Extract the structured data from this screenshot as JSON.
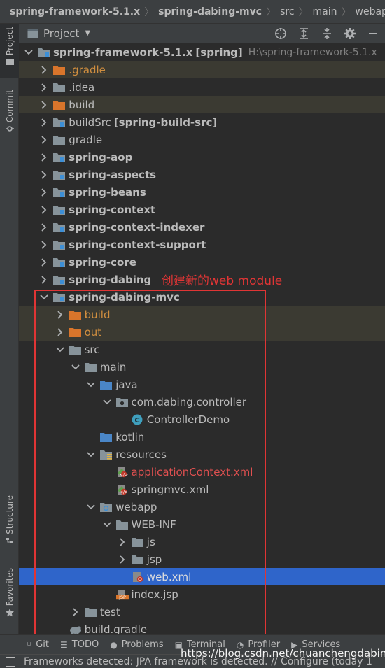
{
  "breadcrumb": {
    "items": [
      {
        "label": "spring-framework-5.1.x",
        "bold": true
      },
      {
        "label": "spring-dabing-mvc",
        "bold": true
      },
      {
        "label": "src",
        "bold": false
      },
      {
        "label": "main",
        "bold": false
      },
      {
        "label": "webapp",
        "bold": false
      }
    ]
  },
  "left_stripe": {
    "project": "Project",
    "commit": "Commit",
    "structure": "Structure",
    "favorites": "Favorites"
  },
  "project_panel": {
    "title": "Project",
    "tools": [
      "locate-icon",
      "expand-all-icon",
      "collapse-all-icon",
      "settings-icon",
      "hide-icon"
    ]
  },
  "tree": [
    {
      "depth": 0,
      "arrow": "down",
      "icon": "module-folder",
      "label": "spring-framework-5.1.x",
      "label_bold": true,
      "suffix": "[spring]",
      "hint": "H:\\spring-framework-5.1.x",
      "style": "normal"
    },
    {
      "depth": 1,
      "arrow": "right",
      "icon": "excluded-folder",
      "label": ".gradle",
      "style": "orange",
      "row": "excluded"
    },
    {
      "depth": 1,
      "arrow": "right",
      "icon": "folder",
      "label": ".idea",
      "style": "normal"
    },
    {
      "depth": 1,
      "arrow": "right",
      "icon": "excluded-folder",
      "label": "build",
      "style": "normal",
      "row": "excluded"
    },
    {
      "depth": 1,
      "arrow": "right",
      "icon": "module-folder",
      "label": "buildSrc",
      "suffix": "[spring-build-src]",
      "style": "normal"
    },
    {
      "depth": 1,
      "arrow": "right",
      "icon": "folder",
      "label": "gradle",
      "style": "normal"
    },
    {
      "depth": 1,
      "arrow": "right",
      "icon": "module-folder",
      "label": "spring-aop",
      "label_bold": true,
      "style": "normal"
    },
    {
      "depth": 1,
      "arrow": "right",
      "icon": "module-folder",
      "label": "spring-aspects",
      "label_bold": true,
      "style": "normal"
    },
    {
      "depth": 1,
      "arrow": "right",
      "icon": "module-folder",
      "label": "spring-beans",
      "label_bold": true,
      "style": "normal"
    },
    {
      "depth": 1,
      "arrow": "right",
      "icon": "module-folder",
      "label": "spring-context",
      "label_bold": true,
      "style": "normal"
    },
    {
      "depth": 1,
      "arrow": "right",
      "icon": "module-folder",
      "label": "spring-context-indexer",
      "label_bold": true,
      "style": "normal"
    },
    {
      "depth": 1,
      "arrow": "right",
      "icon": "module-folder",
      "label": "spring-context-support",
      "label_bold": true,
      "style": "normal"
    },
    {
      "depth": 1,
      "arrow": "right",
      "icon": "module-folder",
      "label": "spring-core",
      "label_bold": true,
      "style": "normal"
    },
    {
      "depth": 1,
      "arrow": "right",
      "icon": "module-folder",
      "label": "spring-dabing",
      "label_bold": true,
      "style": "normal"
    },
    {
      "depth": 1,
      "arrow": "down",
      "icon": "module-folder",
      "label": "spring-dabing-mvc",
      "label_bold": true,
      "style": "normal"
    },
    {
      "depth": 2,
      "arrow": "right",
      "icon": "excluded-folder",
      "label": "build",
      "style": "orange",
      "row": "excluded"
    },
    {
      "depth": 2,
      "arrow": "right",
      "icon": "excluded-folder",
      "label": "out",
      "style": "orange",
      "row": "excluded"
    },
    {
      "depth": 2,
      "arrow": "down",
      "icon": "folder",
      "label": "src",
      "style": "normal"
    },
    {
      "depth": 3,
      "arrow": "down",
      "icon": "folder",
      "label": "main",
      "style": "normal"
    },
    {
      "depth": 4,
      "arrow": "down",
      "icon": "source-folder",
      "label": "java",
      "style": "normal"
    },
    {
      "depth": 5,
      "arrow": "down",
      "icon": "package-folder",
      "label": "com.dabing.controller",
      "style": "normal"
    },
    {
      "depth": 6,
      "arrow": "none",
      "icon": "class-file",
      "label": "ControllerDemo",
      "style": "normal"
    },
    {
      "depth": 4,
      "arrow": "none",
      "icon": "source-folder",
      "label": "kotlin",
      "style": "normal"
    },
    {
      "depth": 4,
      "arrow": "down",
      "icon": "resources-folder",
      "label": "resources",
      "style": "normal"
    },
    {
      "depth": 5,
      "arrow": "none",
      "icon": "spring-xml-file",
      "label": "applicationContext.xml",
      "style": "red"
    },
    {
      "depth": 5,
      "arrow": "none",
      "icon": "spring-xml-file",
      "label": "springmvc.xml",
      "style": "normal"
    },
    {
      "depth": 4,
      "arrow": "down",
      "icon": "web-folder",
      "label": "webapp",
      "style": "normal"
    },
    {
      "depth": 5,
      "arrow": "down",
      "icon": "folder",
      "label": "WEB-INF",
      "style": "normal"
    },
    {
      "depth": 6,
      "arrow": "right",
      "icon": "folder",
      "label": "js",
      "style": "normal"
    },
    {
      "depth": 6,
      "arrow": "right",
      "icon": "folder",
      "label": "jsp",
      "style": "normal"
    },
    {
      "depth": 6,
      "arrow": "none",
      "icon": "web-xml-file",
      "label": "web.xml",
      "style": "white",
      "row": "selected"
    },
    {
      "depth": 5,
      "arrow": "none",
      "icon": "jsp-file",
      "label": "index.jsp",
      "style": "normal"
    },
    {
      "depth": 3,
      "arrow": "right",
      "icon": "folder",
      "label": "test",
      "style": "normal"
    },
    {
      "depth": 2,
      "arrow": "none",
      "icon": "gradle-file",
      "label": "build.gradle",
      "style": "normal"
    }
  ],
  "annotation": {
    "text": "创建新的web module",
    "color": "#e03535"
  },
  "bottom_tabs": [
    {
      "icon": "git-icon",
      "label": "Git"
    },
    {
      "icon": "todo-icon",
      "label": "TODO"
    },
    {
      "icon": "problems-icon",
      "label": "Problems"
    },
    {
      "icon": "terminal-icon",
      "label": "Terminal"
    },
    {
      "icon": "profiler-icon",
      "label": "Profiler"
    },
    {
      "icon": "services-icon",
      "label": "Services"
    }
  ],
  "status": {
    "text": "Frameworks detected: JPA framework is detected. // Configure (today 1"
  },
  "watermark": "https://blog.csdn.net/chuanchengdabing",
  "colors": {
    "background": "#2b2b2b",
    "panel": "#3c3f41",
    "selection": "#2f65ca",
    "excluded_row": "#3b3a32",
    "excluded_text": "#d08e3f"
  }
}
